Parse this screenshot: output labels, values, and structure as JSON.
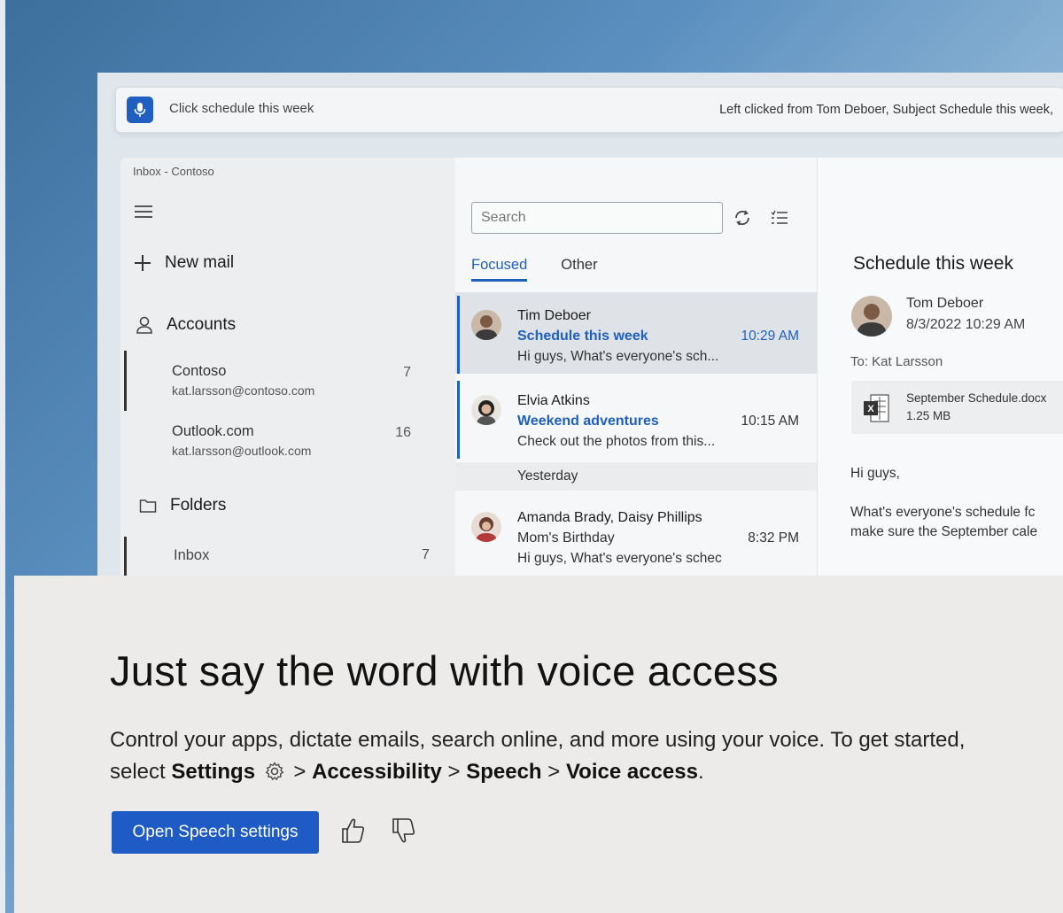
{
  "voice_bar": {
    "command_text": "Click schedule this week",
    "status_text": "Left clicked from Tom Deboer, Subject Schedule this week,"
  },
  "mail": {
    "window_title": "Inbox - Contoso",
    "nav": {
      "new_mail_label": "New mail",
      "accounts_label": "Accounts",
      "accounts": [
        {
          "name": "Contoso",
          "email": "kat.larsson@contoso.com",
          "count": "7"
        },
        {
          "name": "Outlook.com",
          "email": "kat.larsson@outlook.com",
          "count": "16"
        }
      ],
      "folders_label": "Folders",
      "folders": [
        {
          "name": "Inbox",
          "count": "7"
        }
      ]
    },
    "list": {
      "search_placeholder": "Search",
      "tabs": [
        "Focused",
        "Other"
      ],
      "messages": [
        {
          "from": "Tim Deboer",
          "subject": "Schedule this week",
          "time": "10:29 AM",
          "preview": "Hi guys, What's everyone's sch..."
        },
        {
          "from": "Elvia Atkins",
          "subject": "Weekend adventures",
          "time": "10:15 AM",
          "preview": "Check out the photos from this..."
        }
      ],
      "day_separator": "Yesterday",
      "older_messages": [
        {
          "from": "Amanda Brady, Daisy Phillips",
          "subject": "Mom's Birthday",
          "time": "8:32 PM",
          "preview": "Hi guys, What's everyone's schec"
        }
      ]
    },
    "reading": {
      "subject": "Schedule this week",
      "from": "Tom Deboer",
      "date": "8/3/2022  10:29 AM",
      "to": "To: Kat Larsson",
      "attachment_name": "September Schedule.docx",
      "attachment_size": "1.25 MB",
      "greeting": "Hi guys,",
      "body_line1": "What's everyone's schedule fc",
      "body_line2": "make sure the September cale"
    }
  },
  "promo": {
    "heading": "Just say the word with voice access",
    "text_prefix": "Control your apps, dictate emails, search online, and more using your voice. To get started, select",
    "path_settings": "Settings",
    "sep": ">",
    "path_accessibility": "Accessibility",
    "path_speech": "Speech",
    "path_voice_access": "Voice access",
    "period": ".",
    "button_label": "Open Speech settings"
  },
  "colors": {
    "accent": "#1e5fbf",
    "button": "#1f5bc4"
  }
}
